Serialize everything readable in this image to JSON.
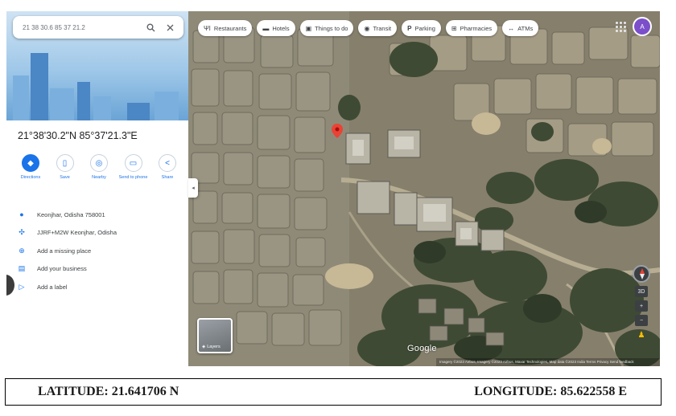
{
  "search": {
    "value": "21 38 30.6 85 37 21.2",
    "search_icon": "search-icon",
    "close_icon": "close-icon"
  },
  "place": {
    "coordinates": "21°38'30.2\"N 85°37'21.3\"E"
  },
  "actions": [
    {
      "label": "Directions",
      "icon": "directions-icon"
    },
    {
      "label": "Save",
      "icon": "bookmark-icon"
    },
    {
      "label": "Nearby",
      "icon": "nearby-icon"
    },
    {
      "label": "Send to phone",
      "icon": "phone-icon"
    },
    {
      "label": "Share",
      "icon": "share-icon"
    }
  ],
  "info_rows": [
    {
      "text": "Keonjhar, Odisha 758001",
      "icon": "location-pin-icon"
    },
    {
      "text": "JJRF+M2W Keonjhar, Odisha",
      "icon": "plus-code-icon"
    },
    {
      "text": "Add a missing place",
      "icon": "add-place-icon"
    },
    {
      "text": "Add your business",
      "icon": "business-icon"
    },
    {
      "text": "Add a label",
      "icon": "label-icon"
    }
  ],
  "chips": [
    {
      "label": "Restaurants",
      "icon": "restaurant-icon"
    },
    {
      "label": "Hotels",
      "icon": "hotel-icon"
    },
    {
      "label": "Things to do",
      "icon": "camera-icon"
    },
    {
      "label": "Transit",
      "icon": "transit-icon"
    },
    {
      "label": "Parking",
      "icon": "parking-icon"
    },
    {
      "label": "Pharmacies",
      "icon": "pharmacy-icon"
    },
    {
      "label": "ATMs",
      "icon": "atm-icon"
    }
  ],
  "account": {
    "initial": "A"
  },
  "map": {
    "layers_label": "Layers",
    "logo": "Google",
    "attribution": "Imagery ©2023 Airbus, Imagery ©2023 Airbus, Maxar Technologies, Map data ©2023   India   Terms   Privacy   Send feedback",
    "zoom_in": "+",
    "zoom_out": "−",
    "view_3d": "3D"
  },
  "caption": {
    "latitude": "LATITUDE: 21.641706 N",
    "longitude": "LONGITUDE: 85.622558 E"
  },
  "colors": {
    "accent": "#1a73e8",
    "pin": "#ea4335",
    "avatar": "#7b4fc9"
  }
}
